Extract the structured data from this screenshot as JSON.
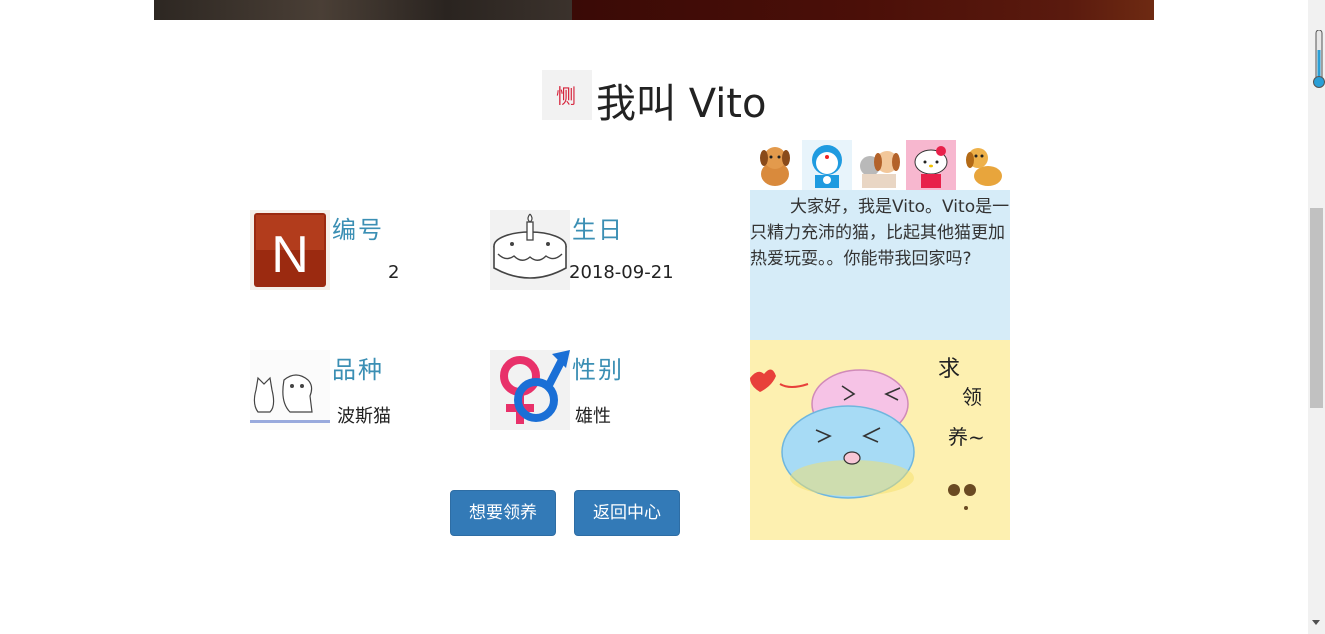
{
  "banner": {
    "left_color": "#2d2722",
    "right_color": "#4b0f08"
  },
  "header": {
    "logo_text": "恻",
    "title": "我叫 Vito"
  },
  "info": {
    "id_label": "编号",
    "id_value": "2",
    "birthday_label": "生日",
    "birthday_value": "2018-09-21",
    "breed_label": "品种",
    "breed_value": "波斯猫",
    "gender_label": "性别",
    "gender_value": "雄性"
  },
  "icons": {
    "id": "onenote-n-icon",
    "birthday": "birthday-cake-icon",
    "breed": "cat-dog-sketch-icon",
    "gender": "gender-symbols-icon"
  },
  "buttons": {
    "adopt": "想要领养",
    "back": "返回中心"
  },
  "intro": {
    "text": "大家好，我是Vito。Vito是一只精力充沛的猫，比起其他猫更加热爱玩耍。。你能带我回家吗?"
  },
  "adopt_card": {
    "line1": "求",
    "line2": "领",
    "line3": "养~"
  },
  "stickers": [
    "puppy-sticker",
    "doraemon-sticker",
    "cat-dog-sticker",
    "hello-kitty-sticker",
    "dog-sticker"
  ],
  "colors": {
    "label": "#3b8fb4",
    "button": "#337ab7",
    "intro_bg": "#d6ecf8",
    "card_bg": "#fdf0b0"
  }
}
